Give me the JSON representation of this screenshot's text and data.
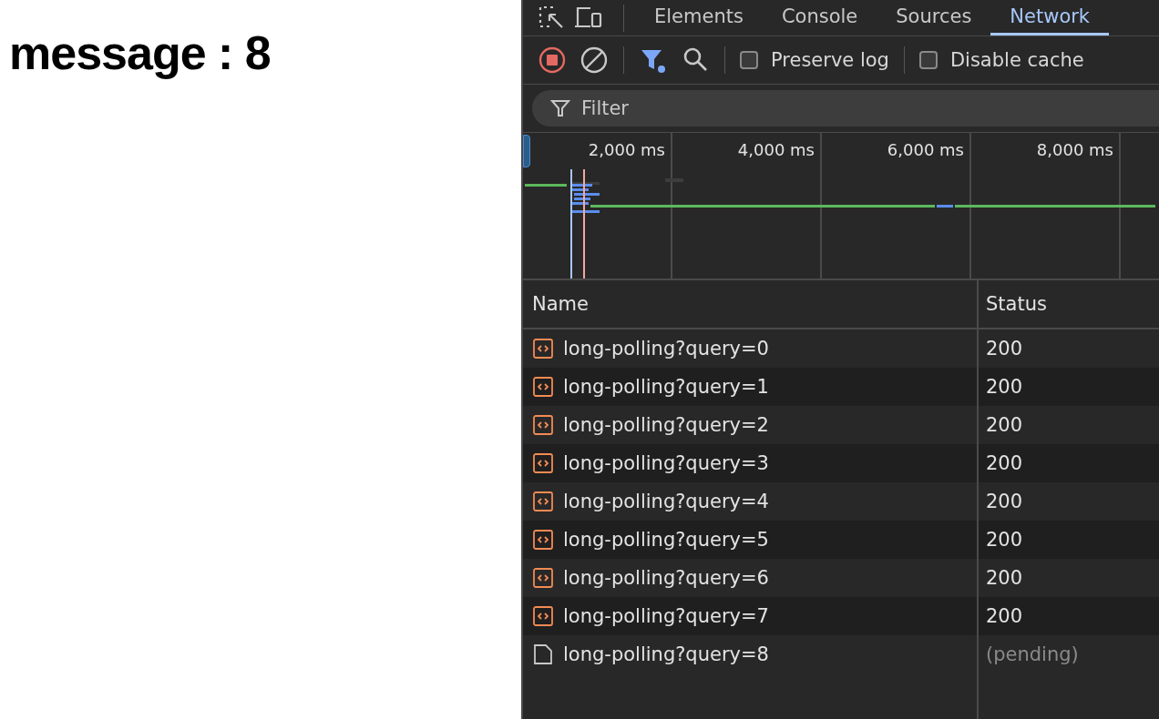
{
  "page": {
    "heading": "message : 8"
  },
  "devtools": {
    "tabs": [
      {
        "label": "Elements",
        "selected": false
      },
      {
        "label": "Console",
        "selected": false
      },
      {
        "label": "Sources",
        "selected": false
      },
      {
        "label": "Network",
        "selected": true
      }
    ],
    "toolbar": {
      "recording": true,
      "filter_active": true,
      "preserve_log": {
        "label": "Preserve log",
        "checked": false
      },
      "disable_cache": {
        "label": "Disable cache",
        "checked": false
      }
    },
    "filter": {
      "placeholder": "Filter"
    },
    "timeline": {
      "ticks": [
        "2,000 ms",
        "4,000 ms",
        "6,000 ms",
        "8,000 ms"
      ]
    },
    "table": {
      "columns": [
        "Name",
        "Status"
      ],
      "rows": [
        {
          "kind": "xhr",
          "name": "long-polling?query=0",
          "status": "200"
        },
        {
          "kind": "xhr",
          "name": "long-polling?query=1",
          "status": "200"
        },
        {
          "kind": "xhr",
          "name": "long-polling?query=2",
          "status": "200"
        },
        {
          "kind": "xhr",
          "name": "long-polling?query=3",
          "status": "200"
        },
        {
          "kind": "xhr",
          "name": "long-polling?query=4",
          "status": "200"
        },
        {
          "kind": "xhr",
          "name": "long-polling?query=5",
          "status": "200"
        },
        {
          "kind": "xhr",
          "name": "long-polling?query=6",
          "status": "200"
        },
        {
          "kind": "xhr",
          "name": "long-polling?query=7",
          "status": "200"
        },
        {
          "kind": "pending",
          "name": "long-polling?query=8",
          "status": "(pending)"
        }
      ]
    }
  }
}
